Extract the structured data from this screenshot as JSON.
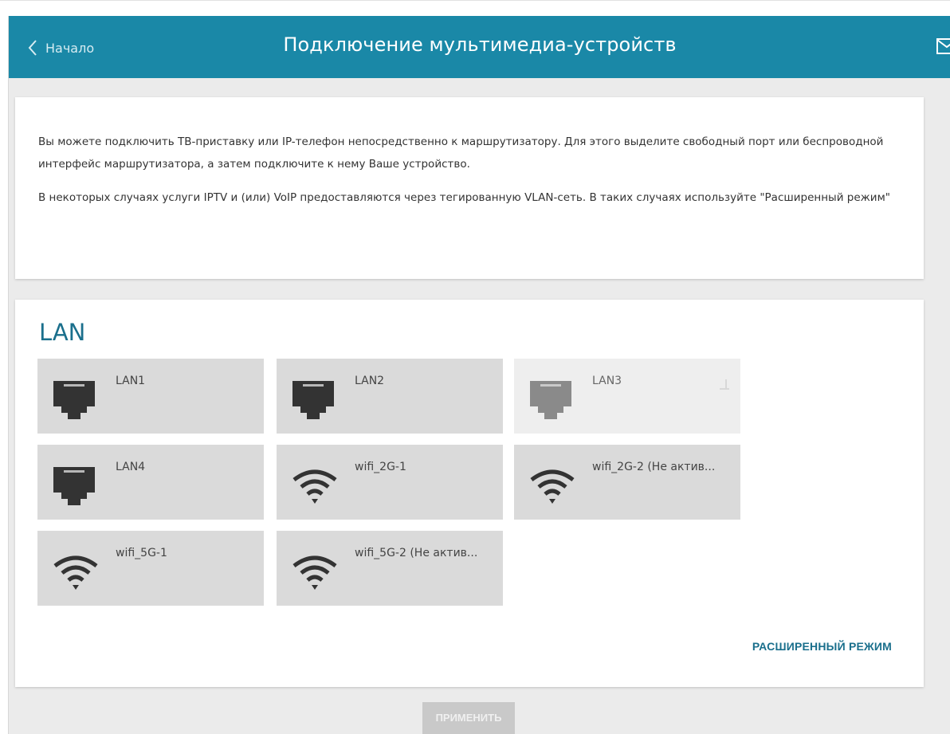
{
  "header": {
    "back_label": "Начало",
    "title": "Подключение мультимедиа-устройств",
    "bg_color": "#1a88a7"
  },
  "info": {
    "paragraph1": "Вы можете подключить ТВ-приставку или IP-телефон непосредственно к маршрутизатору. Для этого выделите свободный порт или беспроводной интерфейс маршрутизатора, а затем подключите к нему Ваше устройство.",
    "paragraph2": "В некоторых случаях услуги IPTV и (или) VoIP предоставляются через тегированную VLAN-сеть. В таких случаях используйте \"Расширенный режим\""
  },
  "lan": {
    "title": "LAN",
    "ports": [
      {
        "label": "LAN1",
        "icon": "ethernet-port-icon",
        "enabled": true
      },
      {
        "label": "LAN2",
        "icon": "ethernet-port-icon",
        "enabled": true
      },
      {
        "label": "LAN3",
        "icon": "ethernet-port-icon",
        "enabled": false
      },
      {
        "label": "LAN4",
        "icon": "ethernet-port-icon",
        "enabled": true
      },
      {
        "label": "wifi_2G-1",
        "icon": "wifi-icon",
        "enabled": true
      },
      {
        "label": "wifi_2G-2 (Не актив...",
        "icon": "wifi-icon",
        "enabled": true
      },
      {
        "label": "wifi_5G-1",
        "icon": "wifi-icon",
        "enabled": true
      },
      {
        "label": "wifi_5G-2 (Не актив...",
        "icon": "wifi-icon",
        "enabled": true
      }
    ],
    "advanced_link": "РАСШИРЕННЫЙ РЕЖИМ"
  },
  "apply_label": "ПРИМЕНИТЬ"
}
